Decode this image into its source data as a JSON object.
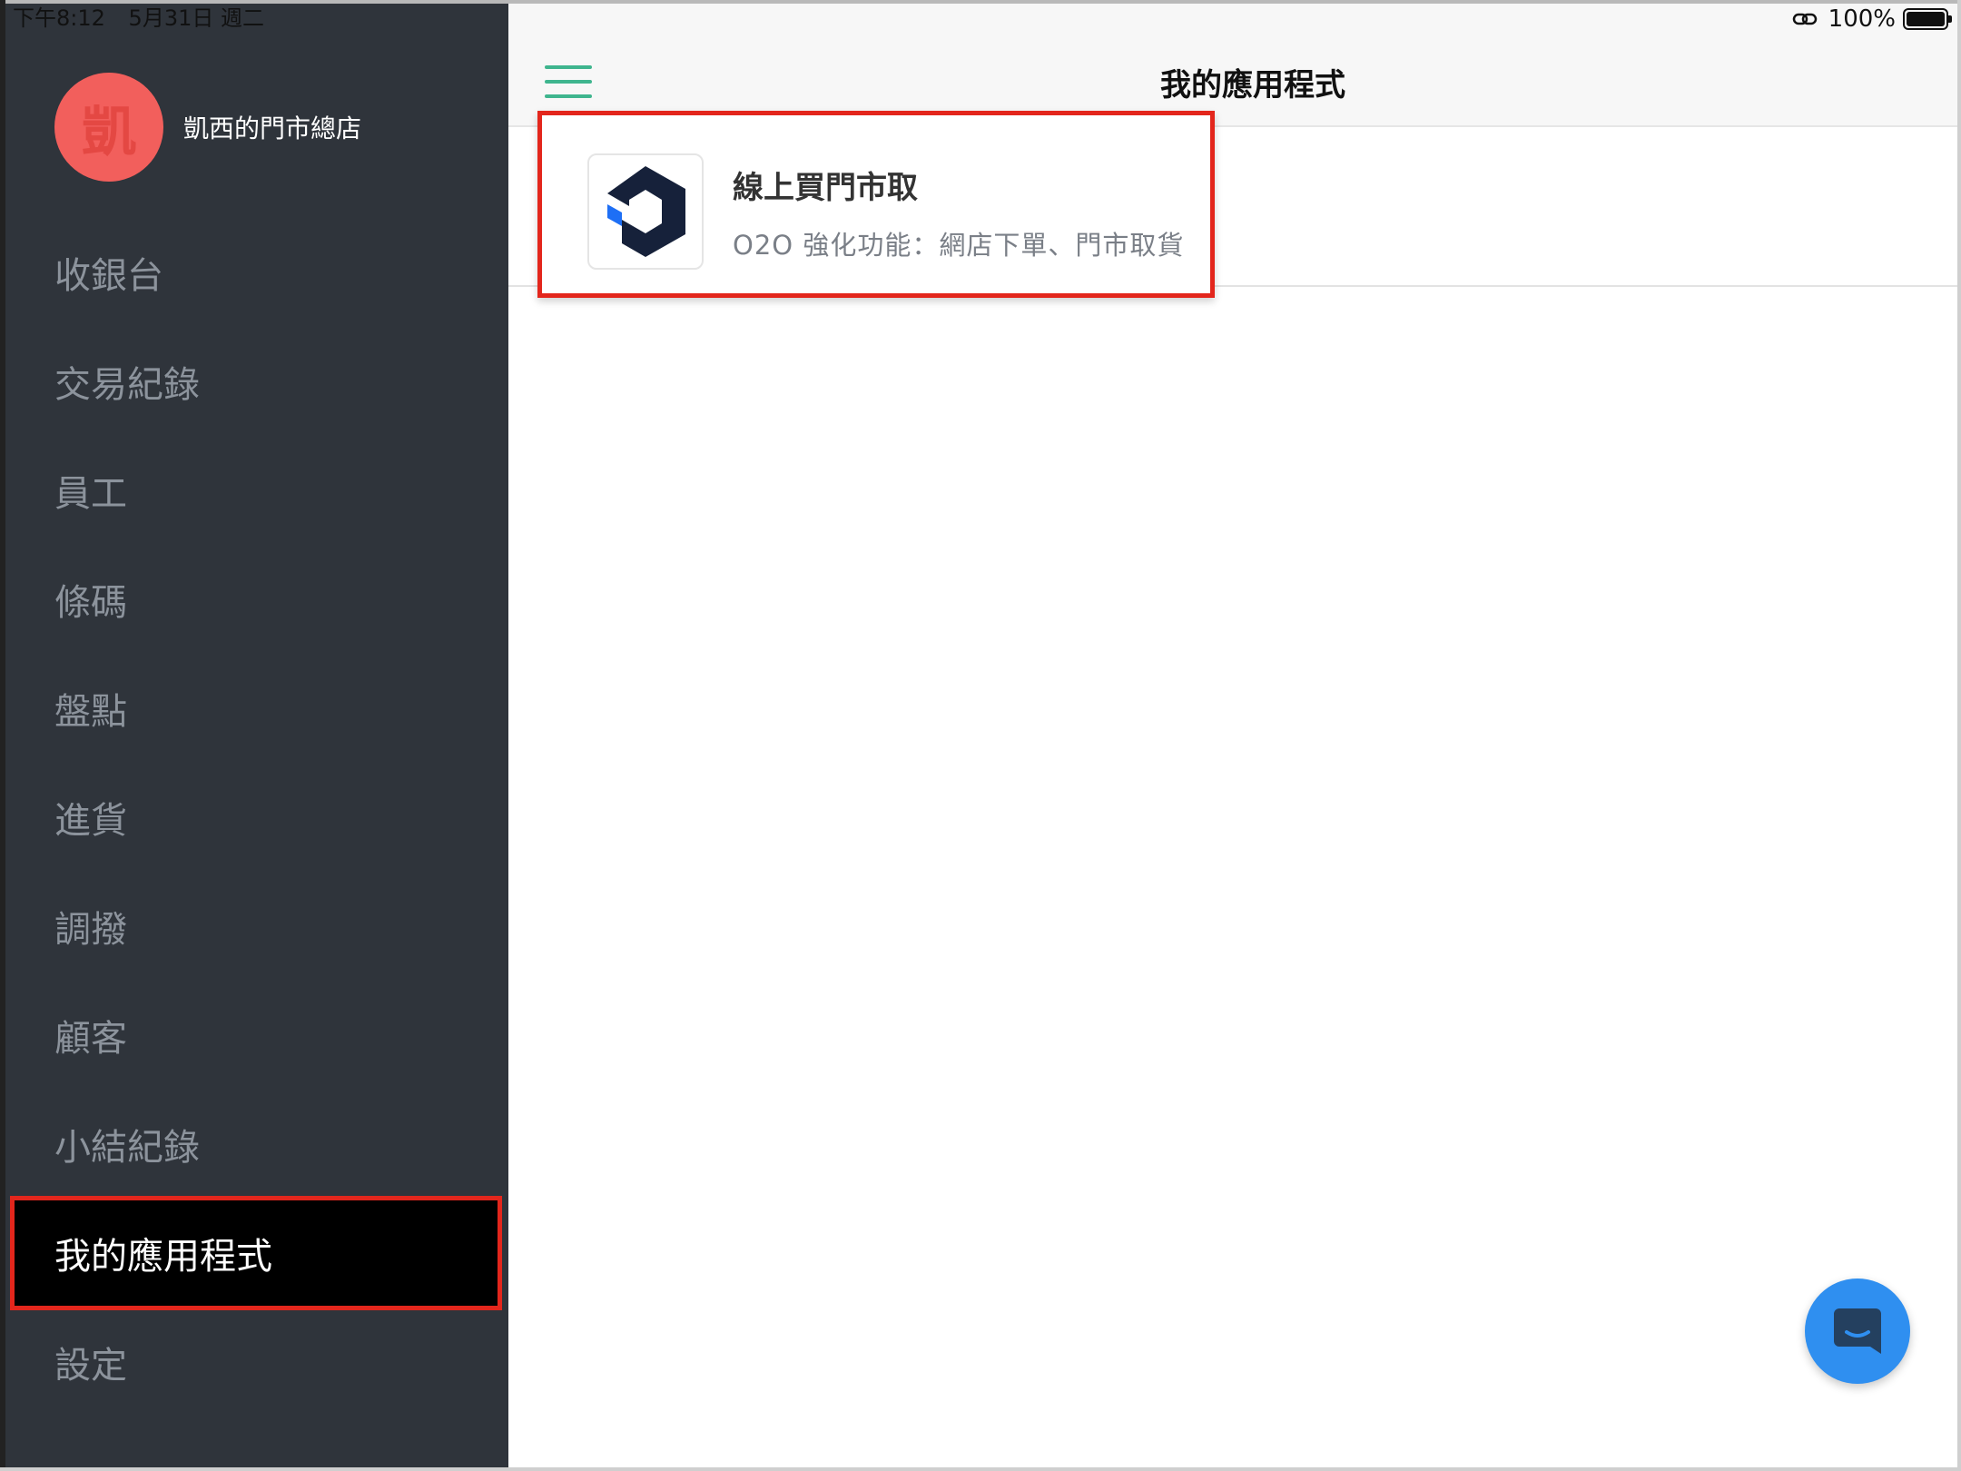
{
  "status_bar": {
    "time": "下午8:12",
    "date": "5月31日 週二",
    "battery": "100%"
  },
  "sidebar": {
    "avatar_letter": "凱",
    "store_name": "凱西的門市總店",
    "items": [
      {
        "label": "收銀台"
      },
      {
        "label": "交易紀錄"
      },
      {
        "label": "員工"
      },
      {
        "label": "條碼"
      },
      {
        "label": "盤點"
      },
      {
        "label": "進貨"
      },
      {
        "label": "調撥"
      },
      {
        "label": "顧客"
      },
      {
        "label": "小結紀錄"
      },
      {
        "label": "我的應用程式"
      },
      {
        "label": "設定"
      }
    ],
    "active_index": 9
  },
  "header": {
    "title": "我的應用程式"
  },
  "apps": [
    {
      "name": "線上買門市取",
      "description": "O2O 強化功能：網店下單、門市取貨",
      "icon": "cube-logo-icon"
    }
  ],
  "colors": {
    "sidebar_bg": "#2f343b",
    "accent_green": "#3fb58e",
    "highlight_red": "#e3261c",
    "avatar_bg": "#f25f5c",
    "chat_blue": "#2f8ff0"
  }
}
